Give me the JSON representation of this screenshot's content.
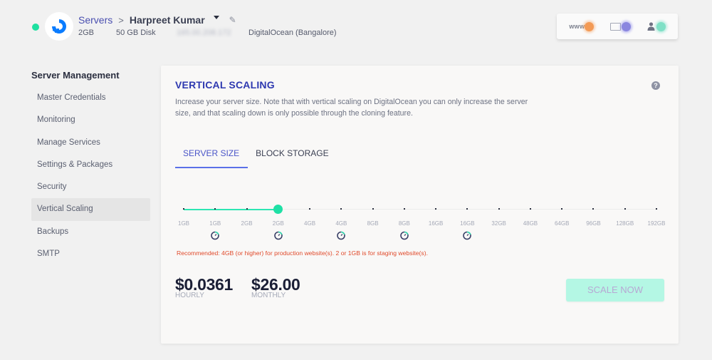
{
  "header": {
    "status": "online",
    "status_color": "#1ee0a0",
    "logo_icon": "digitalocean-logo-icon",
    "breadcrumb": {
      "root": "Servers",
      "separator": ">",
      "current": "Harpreet Kumar"
    },
    "meta": {
      "ram": "2GB",
      "disk": "50 GB Disk",
      "ip": "165.00.208.172",
      "provider": "DigitalOcean (Bangalore)"
    },
    "quick_links": [
      {
        "label": "www",
        "icon": "www-icon",
        "color": "#f39a55"
      },
      {
        "label": "",
        "icon": "folder-icon",
        "color": "#8a86df"
      },
      {
        "label": "",
        "icon": "user-icon",
        "color": "#7fe0c6"
      }
    ]
  },
  "sidebar": {
    "title": "Server Management",
    "items": [
      {
        "label": "Master Credentials",
        "active": false
      },
      {
        "label": "Monitoring",
        "active": false
      },
      {
        "label": "Manage Services",
        "active": false
      },
      {
        "label": "Settings & Packages",
        "active": false
      },
      {
        "label": "Security",
        "active": false
      },
      {
        "label": "Vertical Scaling",
        "active": true
      },
      {
        "label": "Backups",
        "active": false
      },
      {
        "label": "SMTP",
        "active": false
      }
    ]
  },
  "main": {
    "title": "VERTICAL SCALING",
    "help_icon": "?",
    "description": "Increase your server size. Note that with vertical scaling on DigitalOcean you can only increase the server size, and that scaling down is only possible through the cloning feature.",
    "tabs": [
      {
        "label": "SERVER SIZE",
        "active": true
      },
      {
        "label": "BLOCK STORAGE",
        "active": false
      }
    ],
    "slider": {
      "sizes": [
        "1GB",
        "1GB",
        "2GB",
        "2GB",
        "4GB",
        "4GB",
        "8GB",
        "8GB",
        "16GB",
        "16GB",
        "32GB",
        "48GB",
        "64GB",
        "96GB",
        "128GB",
        "192GB"
      ],
      "selected_index": 3,
      "performance_badges_at": [
        1,
        3,
        5,
        7,
        9
      ],
      "accent_color": "#1fe0a5"
    },
    "recommendation": "Recommended: 4GB (or higher) for production website(s). 2 or 1GB is for staging website(s).",
    "pricing": {
      "hourly": "$0.0361",
      "hourly_label": "HOURLY",
      "monthly": "$26.00",
      "monthly_label": "MONTHLY"
    },
    "scale_button": "SCALE NOW"
  }
}
